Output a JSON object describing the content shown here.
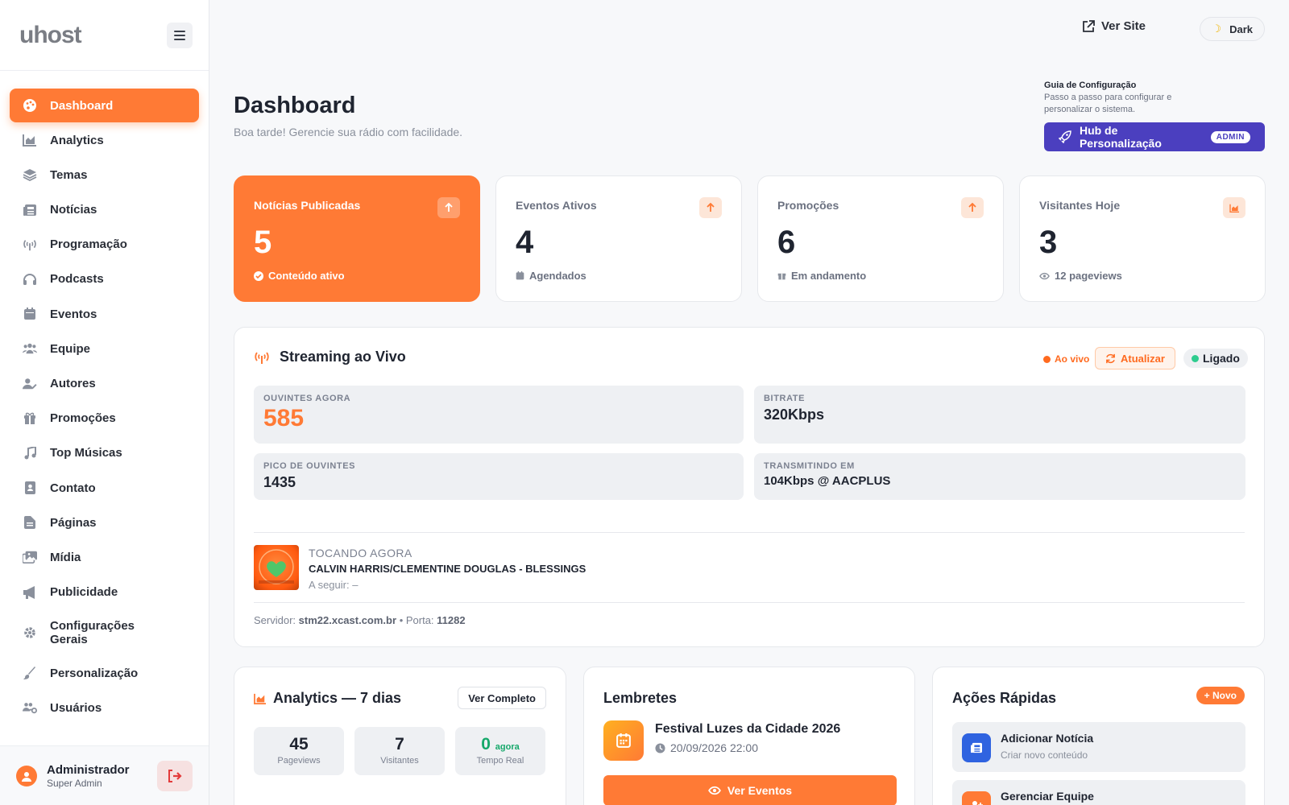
{
  "brand": {
    "logo": "uhost"
  },
  "sidebar": {
    "items": [
      {
        "label": "Dashboard",
        "icon": "palette-icon",
        "active": true
      },
      {
        "label": "Analytics",
        "icon": "chart-area-icon"
      },
      {
        "label": "Temas",
        "icon": "layers-icon"
      },
      {
        "label": "Notícias",
        "icon": "newspaper-icon"
      },
      {
        "label": "Programação",
        "icon": "broadcast-tower-icon"
      },
      {
        "label": "Podcasts",
        "icon": "headphones-icon"
      },
      {
        "label": "Eventos",
        "icon": "calendar-icon"
      },
      {
        "label": "Equipe",
        "icon": "users-icon"
      },
      {
        "label": "Autores",
        "icon": "user-pen-icon"
      },
      {
        "label": "Promoções",
        "icon": "gift-icon"
      },
      {
        "label": "Top Músicas",
        "icon": "music-icon"
      },
      {
        "label": "Contato",
        "icon": "address-book-icon"
      },
      {
        "label": "Páginas",
        "icon": "file-icon"
      },
      {
        "label": "Mídia",
        "icon": "images-icon"
      },
      {
        "label": "Publicidade",
        "icon": "bullhorn-icon"
      },
      {
        "label": "Configurações Gerais",
        "icon": "gear-icon"
      },
      {
        "label": "Personalização",
        "icon": "brush-icon"
      },
      {
        "label": "Usuários",
        "icon": "users-cog-icon"
      }
    ],
    "user": {
      "name": "Administrador",
      "role": "Super Admin"
    }
  },
  "topbar": {
    "ver_site": "Ver Site",
    "theme_toggle": "Dark"
  },
  "header": {
    "title": "Dashboard",
    "subtitle": "Boa tarde! Gerencie sua rádio com facilidade.",
    "guide_title": "Guia de Configuração",
    "guide_desc": "Passo a passo para configurar e personalizar o sistema.",
    "hub_button": "Hub de Personalização",
    "hub_badge": "ADMIN"
  },
  "stats": [
    {
      "label": "Notícias Publicadas",
      "value": "5",
      "foot": "Conteúdo ativo"
    },
    {
      "label": "Eventos Ativos",
      "value": "4",
      "foot": "Agendados"
    },
    {
      "label": "Promoções",
      "value": "6",
      "foot": "Em andamento"
    },
    {
      "label": "Visitantes Hoje",
      "value": "3",
      "foot": "12 pageviews"
    }
  ],
  "streaming": {
    "title": "Streaming ao Vivo",
    "live_label": "Ao vivo",
    "refresh_label": "Atualizar",
    "status_label": "Ligado",
    "listeners_label": "OUVINTES AGORA",
    "listeners_value": "585",
    "bitrate_label": "BITRATE",
    "bitrate_value": "320Kbps",
    "peak_label": "PICO DE OUVINTES",
    "peak_value": "1435",
    "transmitting_label": "TRANSMITINDO EM",
    "transmitting_value": "104Kbps @ AACPLUS",
    "now_playing_label": "TOCANDO AGORA",
    "now_playing_song": "CALVIN HARRIS/CLEMENTINE DOUGLAS - BLESSINGS",
    "next_label": "A seguir: –",
    "server_label": "Servidor:",
    "server_value": "stm22.xcast.com.br",
    "port_label": "• Porta:",
    "port_value": "11282"
  },
  "analytics": {
    "title": "Analytics — 7 dias",
    "button": "Ver Completo",
    "pageviews_value": "45",
    "pageviews_label": "Pageviews",
    "visitors_value": "7",
    "visitors_label": "Visitantes",
    "realtime_value": "0",
    "realtime_suffix": "agora",
    "realtime_label": "Tempo Real"
  },
  "reminders": {
    "title": "Lembretes",
    "event_title": "Festival Luzes da Cidade 2026",
    "event_date": "20/09/2026 22:00",
    "button": "Ver Eventos"
  },
  "quick_actions": {
    "title": "Ações Rápidas",
    "new_button": "+ Novo",
    "items": [
      {
        "title": "Adicionar Notícia",
        "sub": "Criar novo conteúdo"
      },
      {
        "title": "Gerenciar Equipe",
        "sub": ""
      }
    ]
  },
  "colors": {
    "accent": "#ff7a35",
    "hub": "#4b3fbf",
    "live": "#ff6a1f",
    "online": "#2ecc8f"
  }
}
